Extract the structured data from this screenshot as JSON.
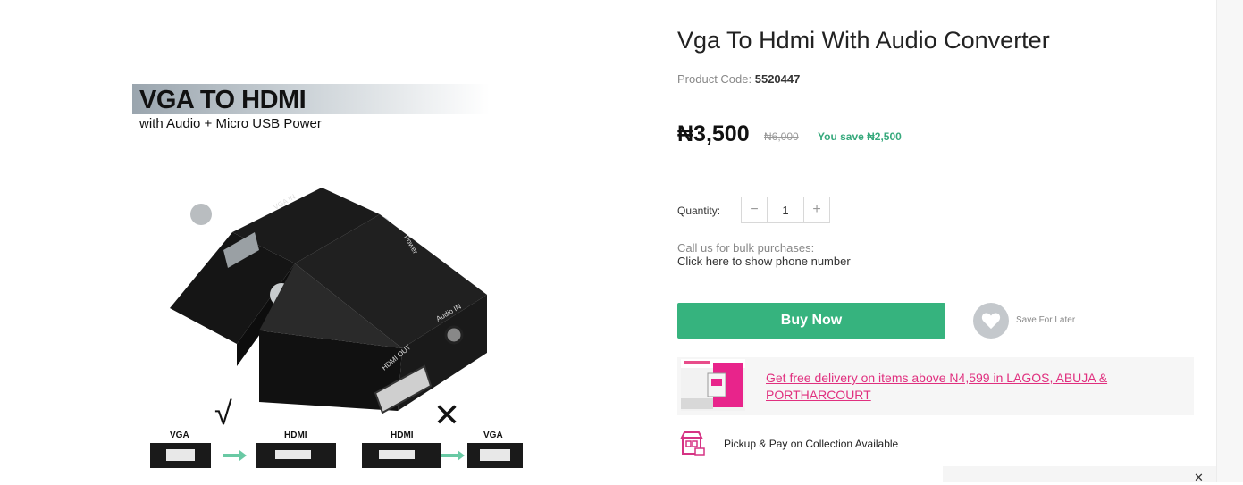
{
  "product": {
    "title": "Vga To Hdmi With Audio Converter",
    "code_label": "Product Code:",
    "code": "5520447",
    "price": "₦3,500",
    "old_price": "₦6,000",
    "savings": "You save ₦2,500"
  },
  "image": {
    "banner_title": "VGA TO HDMI",
    "banner_subtitle": "with Audio + Micro USB Power",
    "port_labels": {
      "vga_in": "VGA IN",
      "power": "Power",
      "audio_in": "Audio IN",
      "hdmi_out": "HDMI OUT"
    },
    "diagram": {
      "vga": "VGA",
      "hdmi": "HDMI",
      "hdmi2": "HDMI",
      "vga2": "VGA",
      "check_mark": "√",
      "cross_mark": "✕"
    }
  },
  "quantity": {
    "label": "Quantity:",
    "value": "1",
    "minus": "−",
    "plus": "+"
  },
  "bulk": {
    "line1": "Call us for bulk purchases:",
    "line2": "Click here to show phone number"
  },
  "actions": {
    "buy_now": "Buy Now",
    "save_for_later": "Save For Later"
  },
  "promo": {
    "text": "Get free delivery on items above N4,599 in LAGOS, ABUJA & PORTHARCOURT"
  },
  "pickup": {
    "text": "Pickup & Pay on Collection Available"
  },
  "colors": {
    "accent_green": "#36b37e",
    "promo_pink": "#e0307f",
    "save_green": "#36a97c"
  },
  "icons": [
    "heart-icon",
    "pickup-store-icon",
    "close-icon",
    "minus-icon",
    "plus-icon"
  ]
}
